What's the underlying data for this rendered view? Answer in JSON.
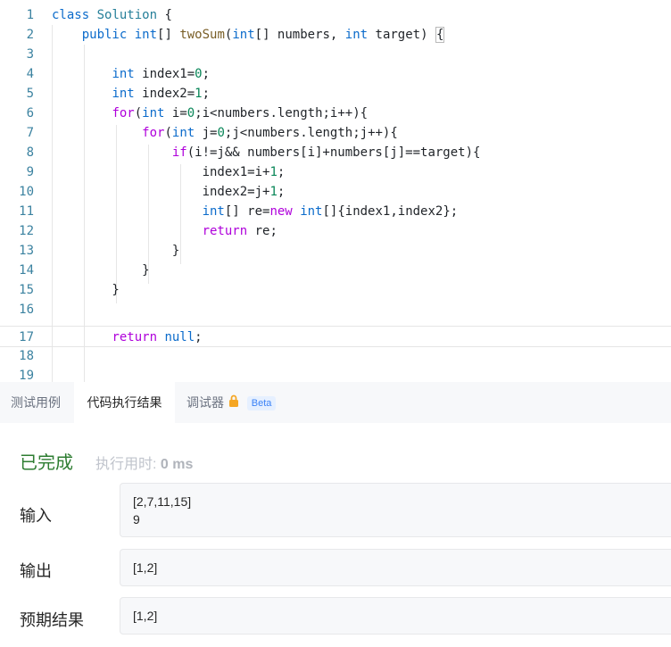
{
  "editor": {
    "line_numbers": [
      "1",
      "2",
      "3",
      "4",
      "5",
      "6",
      "7",
      "8",
      "9",
      "10",
      "11",
      "12",
      "13",
      "14",
      "15",
      "16",
      "17",
      "18",
      "19"
    ],
    "active_line": 17
  },
  "tabs": {
    "items": [
      {
        "label": "测试用例"
      },
      {
        "label": "代码执行结果"
      },
      {
        "label": "调试器"
      }
    ],
    "active": "代码执行结果",
    "beta_label": "Beta"
  },
  "result": {
    "status": "已完成",
    "runtime_label": "执行用时:",
    "runtime_value": "0 ms",
    "input_label": "输入",
    "input_line1": "[2,7,11,15]",
    "input_line2": "9",
    "output_label": "输出",
    "output_value": "[1,2]",
    "expected_label": "预期结果",
    "expected_value": "[1,2]"
  },
  "colors": {
    "keyword": "#0b6bcb",
    "type": "#267f99",
    "function": "#795e26",
    "control": "#af00db",
    "number": "#098658",
    "status_done": "#2e7d32"
  }
}
